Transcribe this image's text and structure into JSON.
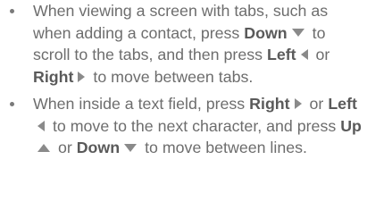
{
  "bullets": [
    {
      "t1": "When viewing a screen with tabs, such as when adding a contact, press",
      "k1": "Down",
      "t2": "to scroll to the tabs, and then press",
      "k2": "Left",
      "t3": "or",
      "k3": "Right",
      "t4": "to move between tabs."
    },
    {
      "t1": "When inside a text field, press",
      "k1": "Right",
      "t2": "or",
      "k2": "Left",
      "t3": "to move to the next character, and press",
      "k3": "Up",
      "t4": "or",
      "k4": "Down",
      "t5": "to move between lines."
    }
  ],
  "icons": {
    "down": "triangle-down",
    "up": "triangle-up",
    "left": "triangle-left",
    "right": "triangle-right"
  },
  "colors": {
    "text": "#6d6d6d",
    "key_text": "#5a5a5a",
    "icon": "#8a8a8a"
  }
}
